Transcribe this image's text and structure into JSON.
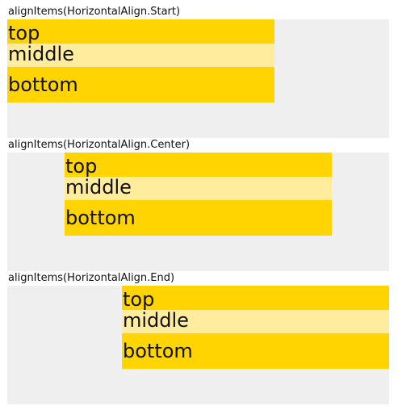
{
  "sections": [
    {
      "caption": "alignItems(HorizontalAlign.Start)",
      "items": [
        "top",
        "middle",
        "bottom"
      ]
    },
    {
      "caption": "alignItems(HorizontalAlign.Center)",
      "items": [
        "top",
        "middle",
        "bottom"
      ]
    },
    {
      "caption": "alignItems(HorizontalAlign.End)",
      "items": [
        "top",
        "middle",
        "bottom"
      ]
    }
  ],
  "colors": {
    "panel_background": "#efefef",
    "item_primary": "#ffd400",
    "item_secondary": "#ffec9d"
  }
}
